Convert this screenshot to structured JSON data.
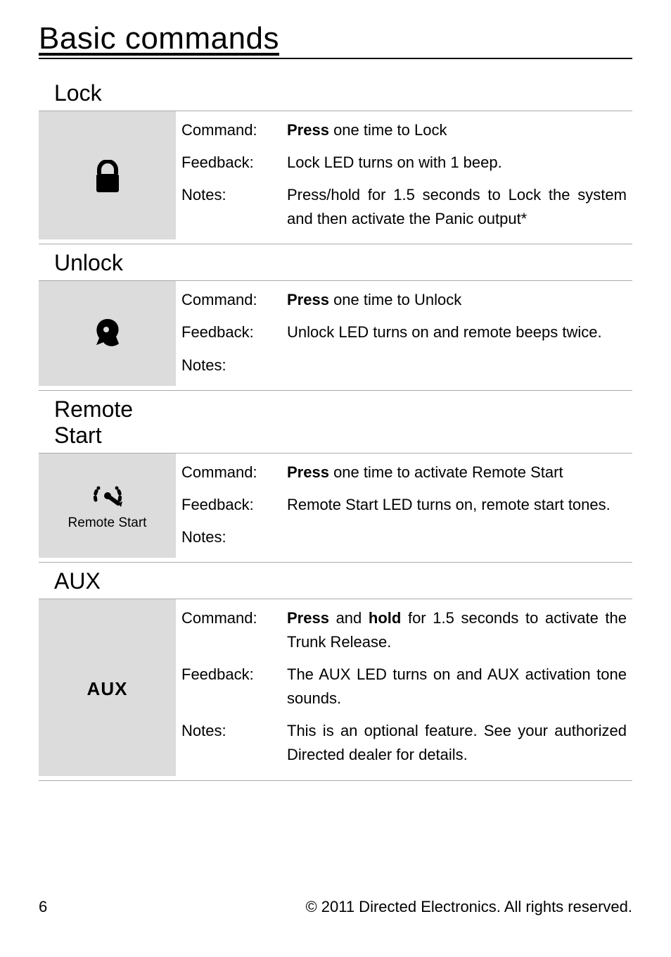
{
  "title": "Basic commands",
  "labels": {
    "command": "Command:",
    "feedback": "Feedback:",
    "notes": "Notes:"
  },
  "sections": {
    "lock": {
      "heading": "Lock",
      "icon_name": "lock-icon",
      "command_bold": "Press",
      "command_rest": " one time to Lock",
      "feedback": "Lock LED turns on with 1 beep.",
      "notes": "Press/hold for 1.5 seconds to Lock the system and then activate the Panic output*"
    },
    "unlock": {
      "heading": "Unlock",
      "icon_name": "unlock-icon",
      "command_bold": "Press",
      "command_rest": " one time to Unlock",
      "feedback": "Unlock LED turns on and remote beeps twice.",
      "notes": ""
    },
    "remote_start": {
      "heading": "Remote Start",
      "icon_caption": "Remote Start",
      "icon_name": "remote-start-icon",
      "command_bold": "Press",
      "command_rest": " one time to activate Remote Start",
      "feedback": "Remote Start LED turns on, remote start tones.",
      "notes": ""
    },
    "aux": {
      "heading": "AUX",
      "icon_text": "AUX",
      "icon_name": "aux-icon",
      "command_b1": "Press",
      "command_mid": " and ",
      "command_b2": "hold",
      "command_rest": " for 1.5 seconds to activate the Trunk Release.",
      "feedback": "The AUX LED turns on and AUX activation tone sounds.",
      "notes": "This is an optional feature. See your authorized Directed dealer for details."
    }
  },
  "footer": {
    "page": "6",
    "copyright": "© 2011 Directed Electronics. All rights reserved."
  }
}
